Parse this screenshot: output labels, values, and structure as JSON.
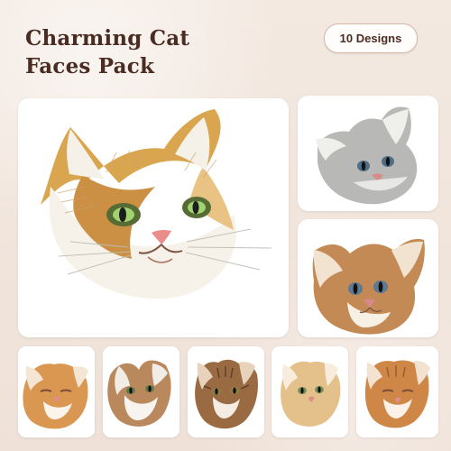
{
  "title": "Charming Cat Faces Pack",
  "badge": "10 Designs"
}
